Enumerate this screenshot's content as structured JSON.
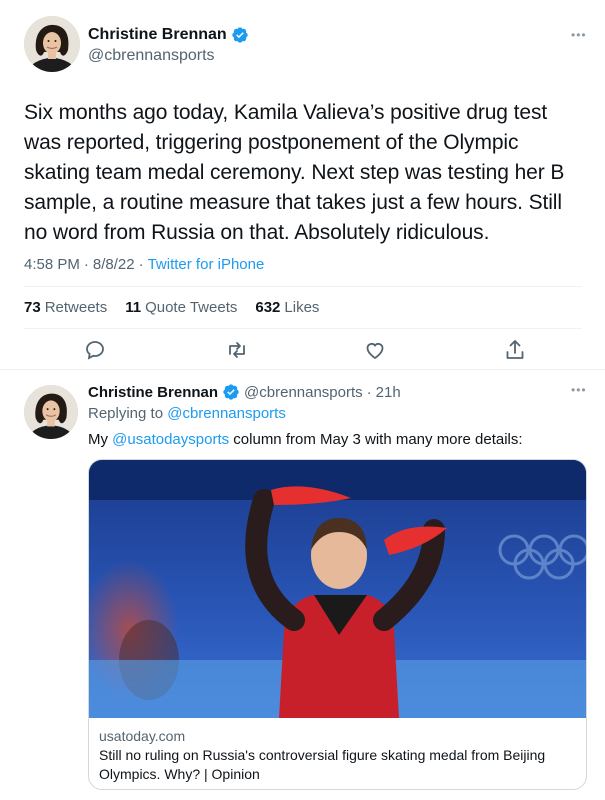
{
  "main_tweet": {
    "author_name": "Christine Brennan",
    "author_handle": "@cbrennansports",
    "text": "Six months ago today, Kamila Valieva’s positive drug test was reported, triggering postponement of the Olympic skating team medal ceremony. Next step was testing her B sample, a routine measure that takes just a few hours. Still no word from Russia on that. Absolutely ridiculous.",
    "time": "4:58 PM",
    "separator": "·",
    "date": "8/8/22",
    "source": "Twitter for iPhone",
    "stats": {
      "retweets_count": "73",
      "retweets_label": "Retweets",
      "quotes_count": "11",
      "quotes_label": "Quote Tweets",
      "likes_count": "632",
      "likes_label": "Likes"
    },
    "actions": [
      "reply-icon",
      "retweet-icon",
      "like-icon",
      "share-icon"
    ]
  },
  "reply_tweet": {
    "author_name": "Christine Brennan",
    "author_handle": "@cbrennansports",
    "separator": "·",
    "time_ago": "21h",
    "replying_prefix": "Replying to",
    "replying_to": "@cbrennansports",
    "text_prefix": "My",
    "text_mention": "@usatodaysports",
    "text_suffix": "column from May 3 with many more details:",
    "card": {
      "domain": "usatoday.com",
      "title": "Still no ruling on Russia's controversial figure skating medal from Beijing Olympics. Why? | Opinion"
    }
  },
  "icons": {
    "verified": "verified-badge-icon",
    "more": "more-options-icon"
  },
  "colors": {
    "accent": "#1d9bf0",
    "text_primary": "#0f1419",
    "text_secondary": "#536471",
    "border": "#eff3f4"
  }
}
